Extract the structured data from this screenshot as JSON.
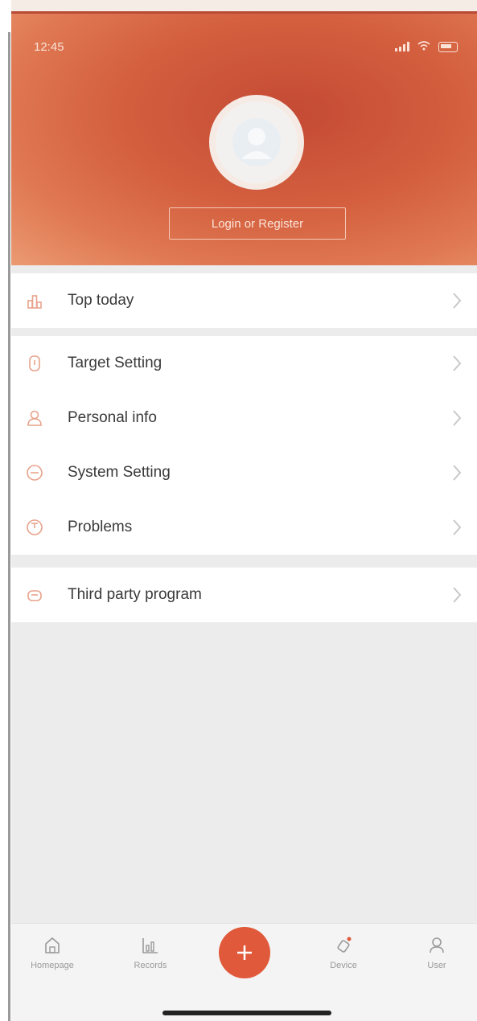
{
  "status_bar": {
    "time": "12:45"
  },
  "header": {
    "login_label": "Login or Register"
  },
  "menu": {
    "group1": [
      {
        "label": "Top today",
        "icon": "trophy-icon"
      }
    ],
    "group2": [
      {
        "label": "Target Setting",
        "icon": "target-icon"
      },
      {
        "label": "Personal info",
        "icon": "person-icon"
      },
      {
        "label": "System Setting",
        "icon": "gear-icon"
      },
      {
        "label": "Problems",
        "icon": "question-icon"
      }
    ],
    "group3": [
      {
        "label": "Third party program",
        "icon": "puzzle-icon"
      }
    ]
  },
  "tabbar": {
    "items": [
      {
        "label": "Homepage",
        "icon": "home-icon"
      },
      {
        "label": "Records",
        "icon": "chart-icon"
      },
      {
        "label": "",
        "icon": "plus-icon"
      },
      {
        "label": "Device",
        "icon": "watch-icon"
      },
      {
        "label": "User",
        "icon": "user-icon"
      }
    ]
  },
  "colors": {
    "accent": "#e0593a",
    "icon": "#e8a38c"
  }
}
